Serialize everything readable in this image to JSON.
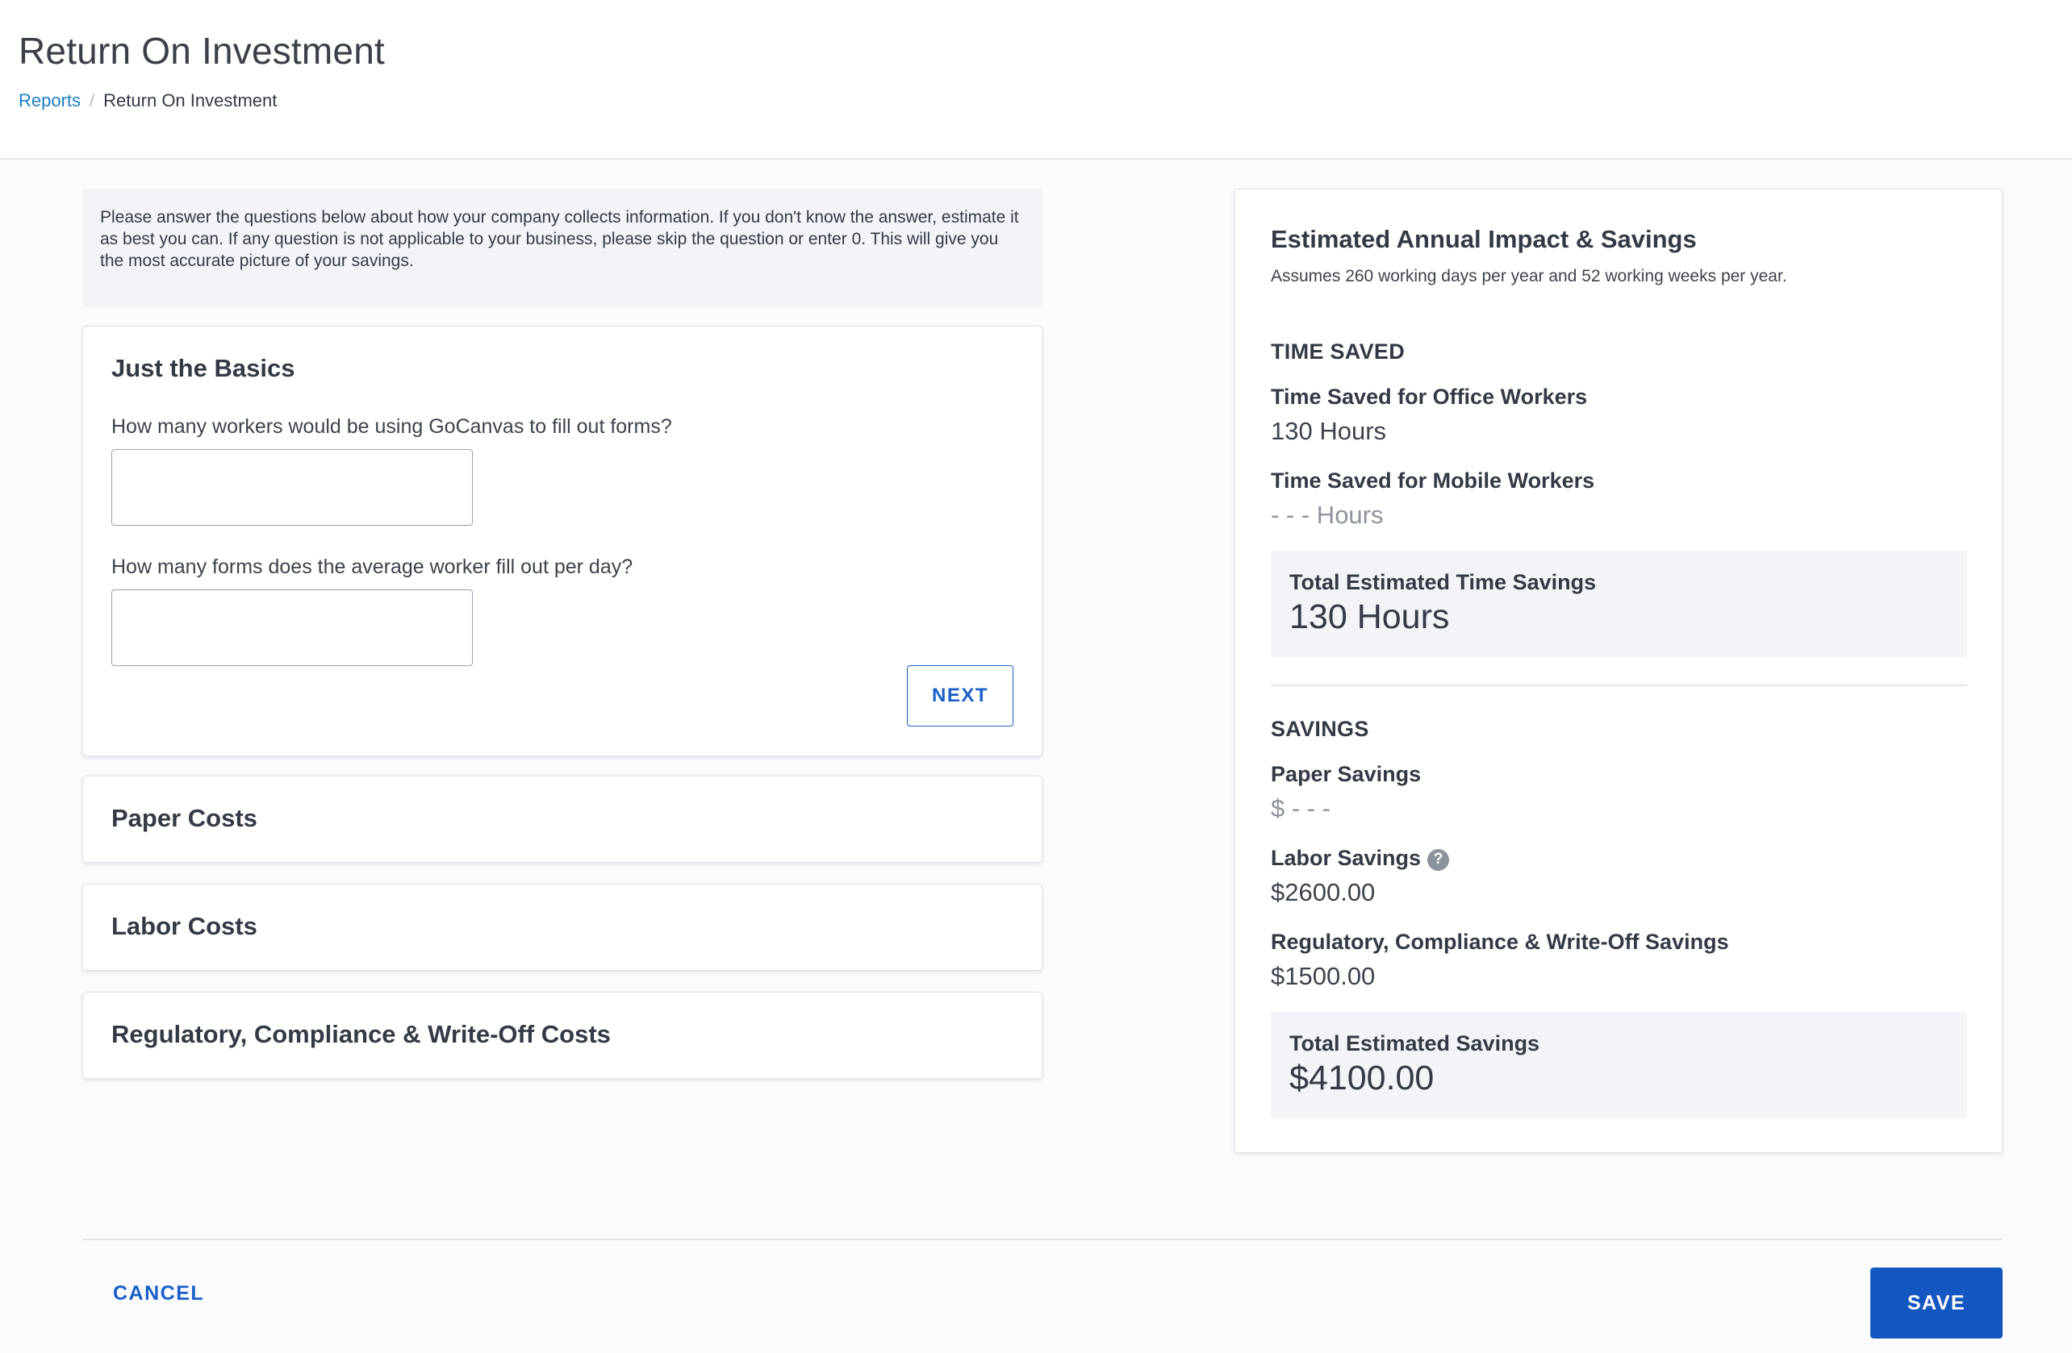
{
  "header": {
    "title": "Return On Investment",
    "breadcrumb": {
      "parent": "Reports",
      "separator": "/",
      "current": "Return On Investment"
    }
  },
  "intro_text": "Please answer the questions below about how your company collects information. If you don't know the answer, estimate it as best you can. If any question is not applicable to your business, please skip the question or enter 0. This will give you the most accurate picture of your savings.",
  "basics": {
    "title": "Just the Basics",
    "q1_label": "How many workers would be using GoCanvas to fill out forms?",
    "q1_value": "",
    "q2_label": "How many forms does the average worker fill out per day?",
    "q2_value": "",
    "next_label": "NEXT"
  },
  "sections": {
    "paper": "Paper Costs",
    "labor": "Labor Costs",
    "regulatory": "Regulatory, Compliance & Write-Off Costs"
  },
  "summary": {
    "title": "Estimated Annual Impact & Savings",
    "subtitle": "Assumes 260 working days per year and 52 working weeks per year.",
    "time_saved": {
      "heading": "TIME SAVED",
      "office_label": "Time Saved for Office Workers",
      "office_value": "130 Hours",
      "mobile_label": "Time Saved for Mobile Workers",
      "mobile_value": "- - - Hours",
      "total_label": "Total Estimated Time Savings",
      "total_value": "130 Hours"
    },
    "savings": {
      "heading": "SAVINGS",
      "paper_label": "Paper Savings",
      "paper_value": "$ - - -",
      "labor_label": "Labor Savings",
      "labor_help": "?",
      "labor_value": "$2600.00",
      "reg_label": "Regulatory, Compliance & Write-Off Savings",
      "reg_value": "$1500.00",
      "total_label": "Total Estimated Savings",
      "total_value": "$4100.00"
    }
  },
  "footer": {
    "cancel_label": "CANCEL",
    "save_label": "SAVE"
  },
  "colors": {
    "link": "#1a7fc4",
    "primary": "#1557c0",
    "panel_bg": "#f2f4f8"
  }
}
